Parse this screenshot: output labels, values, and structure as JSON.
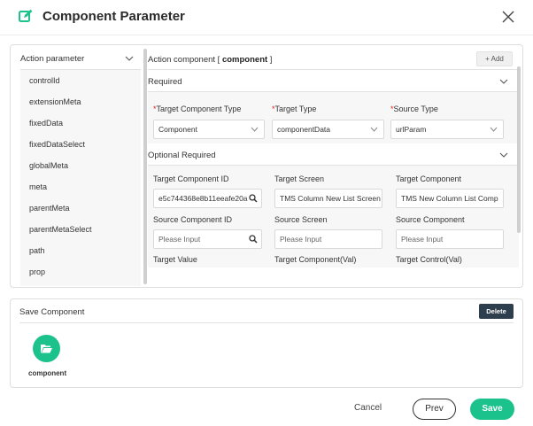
{
  "dialog": {
    "title": "Component Parameter"
  },
  "colors": {
    "accent": "#1bc28b",
    "dark_button": "#2f3e4d",
    "required_star": "#e02020"
  },
  "left_panel": {
    "header": "Action parameter",
    "items": [
      "controlId",
      "extensionMeta",
      "fixedData",
      "fixedDataSelect",
      "globalMeta",
      "meta",
      "parentMeta",
      "parentMetaSelect",
      "path",
      "prop"
    ]
  },
  "right_panel": {
    "header_prefix": "Action component [ ",
    "header_value": "component",
    "header_suffix": " ]",
    "add_label": "Add",
    "required": {
      "title": "Required",
      "target_component_type": {
        "label": "Target Component Type",
        "value": "Component"
      },
      "target_type": {
        "label": "Target Type",
        "value": "componentData"
      },
      "source_type": {
        "label": "Source Type",
        "value": "urlParam"
      }
    },
    "optional": {
      "title": "Optional Required",
      "target_component_id": {
        "label": "Target Component ID",
        "value": "e5c744368e8b11eeafe20a"
      },
      "target_screen": {
        "label": "Target Screen",
        "value": "TMS Column New List Screen"
      },
      "target_component": {
        "label": "Target Component",
        "value": "TMS New Column List Comp"
      },
      "source_component_id": {
        "label": "Source Component ID",
        "placeholder": "Please Input"
      },
      "source_screen": {
        "label": "Source Screen",
        "placeholder": "Please Input"
      },
      "source_component": {
        "label": "Source Component",
        "placeholder": "Please Input"
      },
      "target_value": {
        "label": "Target Value"
      },
      "target_component_val": {
        "label": "Target Component(Val)"
      },
      "target_control_val": {
        "label": "Target Control(Val)"
      }
    }
  },
  "save_component": {
    "title": "Save Component",
    "delete_label": "Delete",
    "component_label": "component"
  },
  "footer": {
    "cancel": "Cancel",
    "prev": "Prev",
    "save": "Save"
  }
}
